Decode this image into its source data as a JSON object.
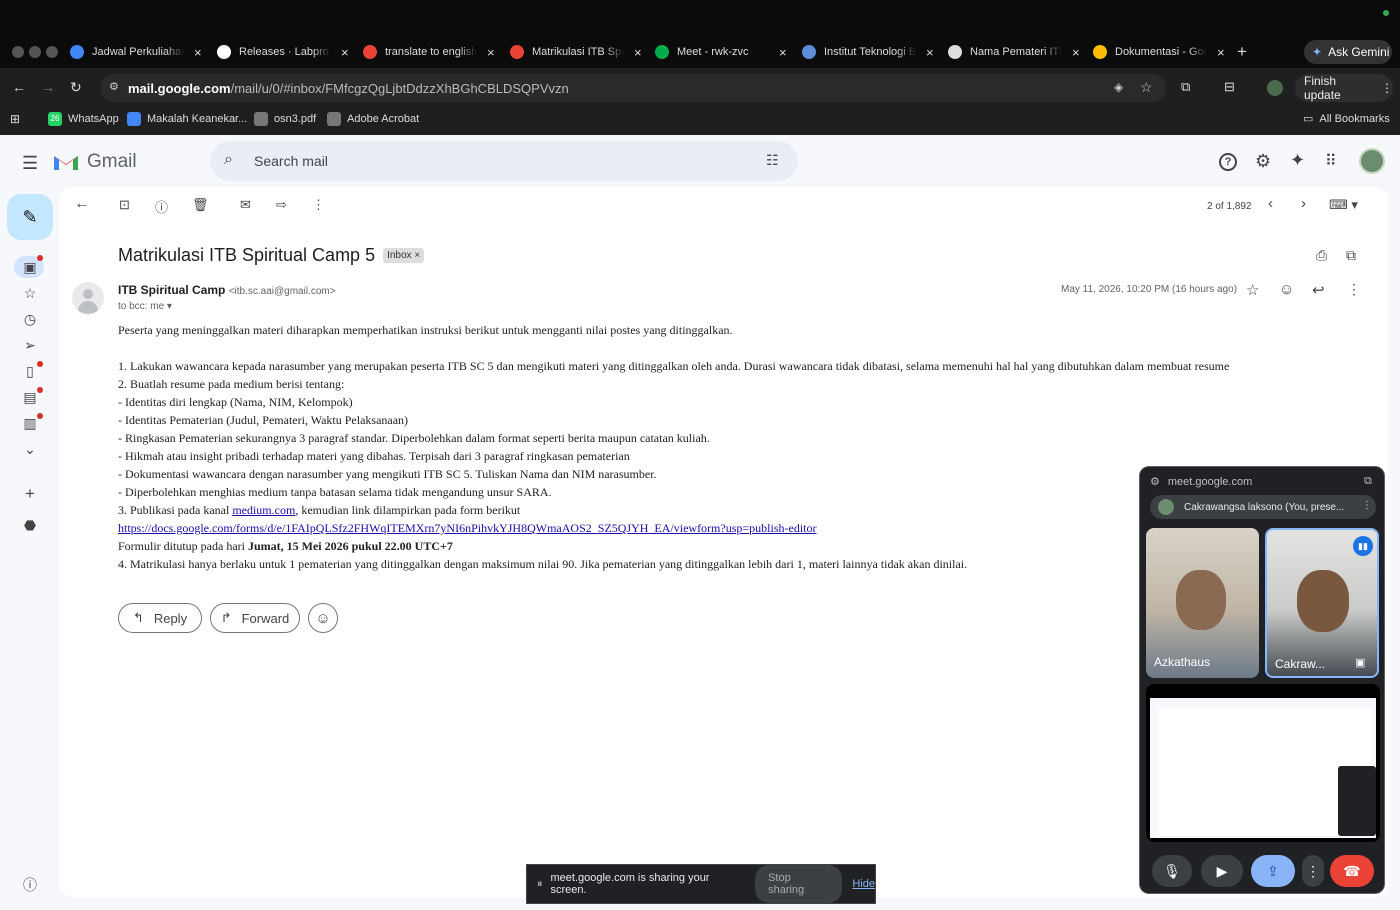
{
  "browser": {
    "tabs": [
      {
        "title": "Jadwal Perkuliahan",
        "icon": "globe-icon",
        "color": "#4285f4"
      },
      {
        "title": "Releases · Labpro-",
        "icon": "github-icon",
        "color": "#ffffff"
      },
      {
        "title": "translate to english",
        "icon": "google-icon",
        "color": "#ea4335"
      },
      {
        "title": "Matrikulasi ITB Spi",
        "icon": "gmail-icon",
        "color": "#ea4335"
      },
      {
        "title": "Meet - rwk-zvc",
        "icon": "meet-icon",
        "color": "#00ac47"
      },
      {
        "title": "Institut Teknologi B",
        "icon": "itb-icon",
        "color": "#5b8dd9"
      },
      {
        "title": "Nama Pemateri ITB",
        "icon": "openai-icon",
        "color": "#dddddd"
      },
      {
        "title": "Dokumentasi - Goo",
        "icon": "drive-icon",
        "color": "#fbbc04"
      }
    ],
    "ask_gemini": "Ask Gemini",
    "url_host": "mail.google.com",
    "url_path": "/mail/u/0/#inbox/FMfcgzQgLjbtDdzzXhBGhCBLDSQPVvzn",
    "finish_update": "Finish update",
    "bookmarks": [
      {
        "label": "WhatsApp",
        "icon": "whatsapp-icon",
        "badge": "26"
      },
      {
        "label": "Makalah Keanekar...",
        "icon": "docs-icon"
      },
      {
        "label": "osn3.pdf",
        "icon": "globe-icon"
      },
      {
        "label": "Adobe Acrobat",
        "icon": "globe-icon"
      }
    ],
    "all_bookmarks": "All Bookmarks"
  },
  "gmail": {
    "logo_text": "Gmail",
    "search_placeholder": "Search mail",
    "pager": "2 of 1,892",
    "subject": "Matrikulasi ITB Spiritual Camp 5",
    "label": "Inbox",
    "sender_name": "ITB Spiritual Camp",
    "sender_email": "<itb.sc.aai@gmail.com>",
    "recipient": "to bcc: me",
    "date": "May 11, 2026, 10:20 PM (16 hours ago)",
    "body_lines": [
      "Peserta yang meninggalkan materi diharapkan memperhatikan instruksi berikut untuk mengganti nilai postes yang ditinggalkan.",
      "1. Lakukan wawancara kepada narasumber yang merupakan peserta ITB SC 5 dan mengikuti materi yang ditinggalkan oleh anda. Durasi wawancara tidak dibatasi, selama memenuhi hal hal yang dibutuhkan dalam membuat resume",
      "2. Buatlah resume pada medium berisi tentang:",
      "- Identitas diri lengkap (Nama, NIM, Kelompok)",
      "- Identitas Pematerian (Judul, Pemateri, Waktu Pelaksanaan)",
      "- Ringkasan Pematerian sekurangnya 3 paragraf standar. Diperbolehkan dalam format seperti berita maupun catatan kuliah.",
      "- Hikmah atau insight pribadi terhadap materi yang dibahas. Terpisah dari 3 paragraf ringkasan pematerian",
      "- Dokumentasi wawancara dengan narasumber yang mengikuti ITB SC 5. Tuliskan Nama dan NIM narasumber.",
      "- Diperbolehkan menghias medium tanpa batasan selama tidak mengandung unsur SARA."
    ],
    "line3_prefix": "3. Publikasi pada kanal ",
    "line3_link": "medium.com",
    "line3_suffix": ", kemudian link dilampirkan pada form berikut",
    "form_link": "https://docs.google.com/forms/d/e/1FAIpQLSfz2FHWqITEMXrn7yNI6nPihvkYJH8QWmaAOS2_SZ5QJYH_EA/viewform?usp=publish-editor",
    "deadline_prefix": "Formulir ditutup pada hari ",
    "deadline_bold": "Jumat, 15 Mei 2026 pukul 22.00 UTC+7",
    "line4": "4. Matrikulasi hanya berlaku untuk 1 pematerian yang ditinggalkan dengan maksimum nilai 90. Jika pematerian yang ditinggalkan lebih dari 1, materi lainnya tidak akan dinilai.",
    "reply_label": "Reply",
    "forward_label": "Forward"
  },
  "meet": {
    "host": "meet.google.com",
    "presenter": "Cakrawangsa laksono (You, prese...",
    "participant1": "Azkathaus",
    "participant2": "Cakraw..."
  },
  "share_bar": {
    "message": "meet.google.com is sharing your screen.",
    "stop": "Stop sharing",
    "hide": "Hide"
  }
}
